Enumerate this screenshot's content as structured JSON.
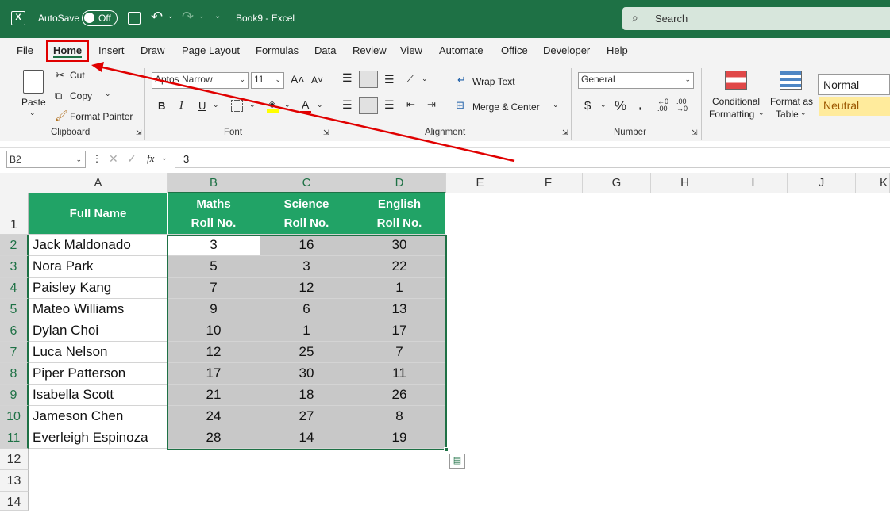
{
  "window": {
    "autosave_label": "AutoSave",
    "autosave_state": "Off",
    "title": "Book9  -  Excel",
    "search_placeholder": "Search"
  },
  "menu": {
    "tabs": [
      "File",
      "Home",
      "Insert",
      "Draw",
      "Page Layout",
      "Formulas",
      "Data",
      "Review",
      "View",
      "Automate",
      "Office",
      "Developer",
      "Help"
    ],
    "active": "Home"
  },
  "ribbon": {
    "clipboard": {
      "paste": "Paste",
      "cut": "Cut",
      "copy": "Copy",
      "format_painter": "Format Painter",
      "group": "Clipboard"
    },
    "font": {
      "name": "Aptos Narrow",
      "size": "11",
      "group": "Font"
    },
    "alignment": {
      "wrap": "Wrap Text",
      "merge": "Merge & Center",
      "group": "Alignment"
    },
    "number": {
      "format": "General",
      "group": "Number"
    },
    "styles": {
      "conditional_1": "Conditional",
      "conditional_2": "Formatting",
      "format_table_1": "Format as",
      "format_table_2": "Table",
      "normal": "Normal",
      "neutral": "Neutral"
    }
  },
  "formula_bar": {
    "name_box": "B2",
    "fx": "fx",
    "value": "3"
  },
  "columns": [
    "A",
    "B",
    "C",
    "D",
    "E",
    "F",
    "G",
    "H",
    "I",
    "J",
    "K"
  ],
  "rows": [
    "1",
    "2",
    "3",
    "4",
    "5",
    "6",
    "7",
    "8",
    "9",
    "10",
    "11",
    "12",
    "13",
    "14"
  ],
  "table": {
    "headers": [
      [
        "Full Name"
      ],
      [
        "Maths",
        "Roll No."
      ],
      [
        "Science",
        "Roll No."
      ],
      [
        "English",
        "Roll No."
      ]
    ],
    "data": [
      [
        "Jack Maldonado",
        "3",
        "16",
        "30"
      ],
      [
        "Nora Park",
        "5",
        "3",
        "22"
      ],
      [
        "Paisley Kang",
        "7",
        "12",
        "1"
      ],
      [
        "Mateo Williams",
        "9",
        "6",
        "13"
      ],
      [
        "Dylan Choi",
        "10",
        "1",
        "17"
      ],
      [
        "Luca Nelson",
        "12",
        "25",
        "7"
      ],
      [
        "Piper Patterson",
        "17",
        "30",
        "11"
      ],
      [
        "Isabella Scott",
        "21",
        "18",
        "26"
      ],
      [
        "Jameson Chen",
        "24",
        "27",
        "8"
      ],
      [
        "Everleigh Espinoza",
        "28",
        "14",
        "19"
      ]
    ]
  },
  "colors": {
    "excel_green": "#1e7145",
    "header_green": "#21a366",
    "selection_gray": "#c8c8c8",
    "annotation_red": "#e00000"
  }
}
